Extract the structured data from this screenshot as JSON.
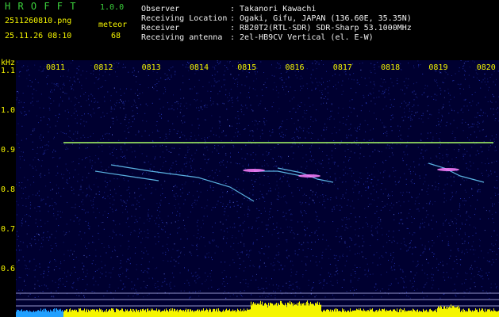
{
  "header": {
    "app_title": "H R O F F T",
    "version": "1.0.0",
    "filename": "2511260810.png",
    "datetime": "25.11.26 08:10",
    "meteor_label": "meteor",
    "meteor_count": "68",
    "info_labels": [
      "Observer",
      "Receiving Location",
      "Receiver",
      "Receiving antenna"
    ],
    "info_values": [
      ": Takanori Kawachi",
      ": Ogaki, Gifu, JAPAN (136.60E, 35.35N)",
      ": R820T2(RTL-SDR) SDR-Sharp 53.1000MHz",
      ": 2el-HB9CV Vertical (el. E-W)"
    ]
  },
  "chart_data": {
    "type": "heatmap",
    "ylabel": "kHz",
    "x_ticks": [
      "0811",
      "0812",
      "0813",
      "0814",
      "0815",
      "0816",
      "0817",
      "0818",
      "0819",
      "0820"
    ],
    "y_ticks": [
      "1.1",
      "1.0",
      "0.9",
      "0.8",
      "0.7",
      "0.6"
    ],
    "carrier_khz": 0.92,
    "colors": {
      "background": "#000030",
      "noise": "#2a3cc8",
      "carrier": "#aaff66",
      "echo": "#ff80ff",
      "axis_text": "#f5f500",
      "header_text": "#3cd23c"
    }
  }
}
